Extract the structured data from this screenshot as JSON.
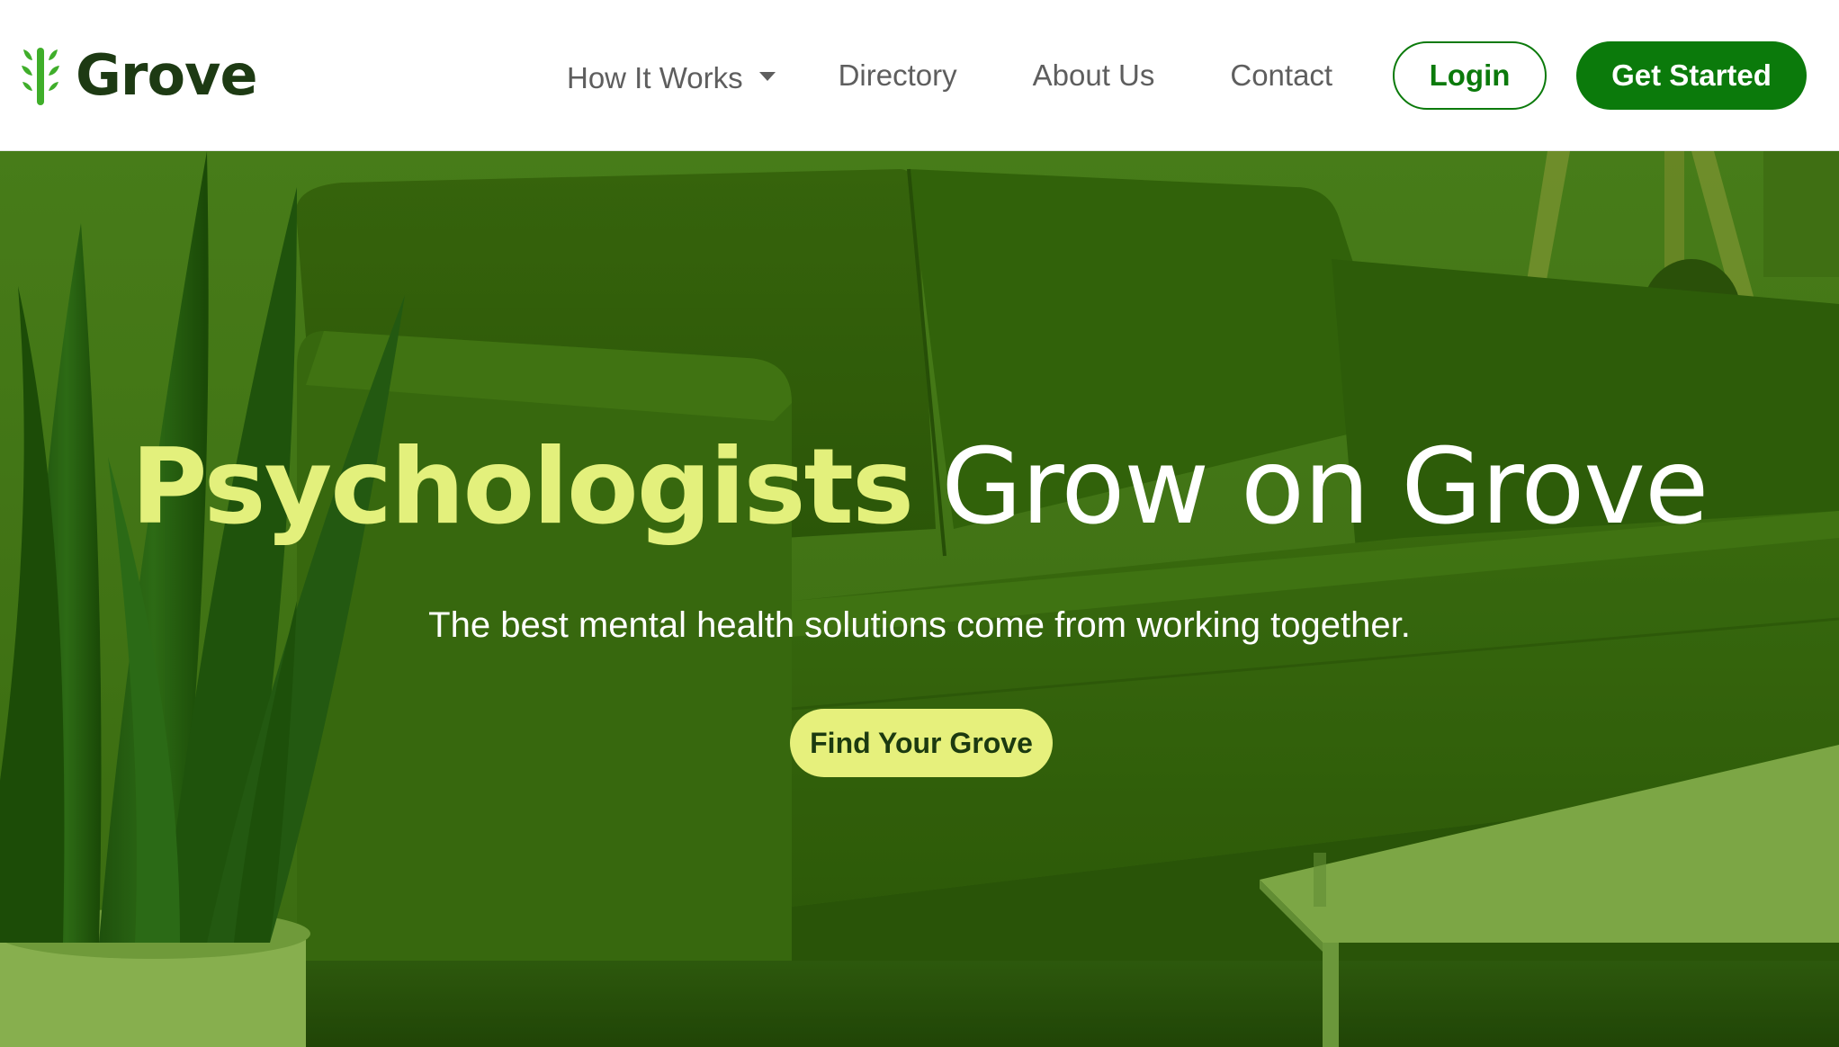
{
  "brand": {
    "name": "Grove",
    "logo_icon": "grove-tree-icon",
    "text_color": "#1d3a13",
    "accent_green": "#0b7a0b",
    "accent_lime": "#e3f07c"
  },
  "nav": {
    "items": [
      {
        "label": "How It Works",
        "has_dropdown": true,
        "icon": "caret-down-icon"
      },
      {
        "label": "Directory"
      },
      {
        "label": "About Us"
      },
      {
        "label": "Contact"
      }
    ],
    "login_label": "Login",
    "cta_label": "Get Started"
  },
  "hero": {
    "title_accent": "Psychologists",
    "title_rest": "Grow on Grove",
    "subtitle": "The best mental health solutions come from working together.",
    "cta_label": "Find Your Grove",
    "background": "green-tinted photo of a leather sofa, snake plant and coffee table",
    "overlay_color": "#3f6f18"
  }
}
